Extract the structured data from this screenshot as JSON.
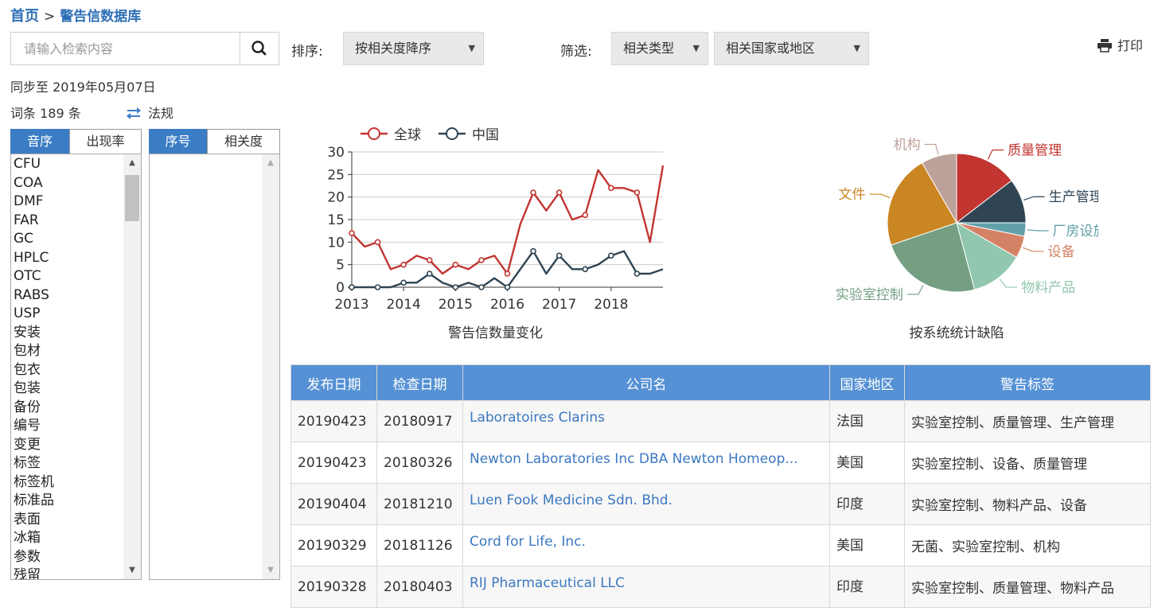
{
  "breadcrumb": {
    "home": "首页",
    "separator": ">",
    "current": "警告信数据库"
  },
  "search": {
    "placeholder": "请输入检索内容",
    "value": ""
  },
  "sort": {
    "label": "排序:",
    "selected": "按相关度降序"
  },
  "filter": {
    "label": "筛选:",
    "type_selected": "相关类型",
    "region_selected": "相关国家或地区"
  },
  "print_label": "打印",
  "sync_text": "同步至 2019年05月07日",
  "count_text": "词条 189 条",
  "law_link": "法规",
  "left_tabs": [
    "音序",
    "出现率"
  ],
  "right_tabs": [
    "序号",
    "相关度"
  ],
  "terms": [
    "CFU",
    "COA",
    "DMF",
    "FAR",
    "GC",
    "HPLC",
    "OTC",
    "RABS",
    "USP",
    "安装",
    "包材",
    "包衣",
    "包装",
    "备份",
    "编号",
    "变更",
    "标签",
    "标签机",
    "标准品",
    "表面",
    "冰箱",
    "参数",
    "残留"
  ],
  "chart_data": [
    {
      "type": "line",
      "title": "警告信数量变化",
      "x_ticks": [
        "2013",
        "2014",
        "2015",
        "2016",
        "2017",
        "2018"
      ],
      "y_ticks": [
        0,
        5,
        10,
        15,
        20,
        25,
        30
      ],
      "ylim": [
        0,
        30
      ],
      "xlim": [
        2013,
        2019
      ],
      "legend_position": "top",
      "grid": true,
      "series": [
        {
          "name": "全球",
          "color": "#c23531",
          "x": [
            2013,
            2013.25,
            2013.5,
            2013.75,
            2014,
            2014.25,
            2014.5,
            2014.75,
            2015,
            2015.25,
            2015.5,
            2015.75,
            2016,
            2016.25,
            2016.5,
            2016.75,
            2017,
            2017.25,
            2017.5,
            2017.75,
            2018,
            2018.25,
            2018.5,
            2018.75,
            2019
          ],
          "y": [
            12,
            9,
            10,
            4,
            5,
            7,
            6,
            3,
            5,
            4,
            6,
            7,
            3,
            14,
            21,
            17,
            21,
            15,
            16,
            26,
            22,
            22,
            21,
            10,
            27
          ],
          "markers": [
            1,
            0,
            1,
            0,
            1,
            0,
            1,
            0,
            1,
            0,
            1,
            0,
            1,
            0,
            1,
            0,
            1,
            0,
            1,
            0,
            1,
            0,
            1,
            0,
            0
          ]
        },
        {
          "name": "中国",
          "color": "#2f4554",
          "x": [
            2013,
            2013.25,
            2013.5,
            2013.75,
            2014,
            2014.25,
            2014.5,
            2014.75,
            2015,
            2015.25,
            2015.5,
            2015.75,
            2016,
            2016.25,
            2016.5,
            2016.75,
            2017,
            2017.25,
            2017.5,
            2017.75,
            2018,
            2018.25,
            2018.5,
            2018.75,
            2019
          ],
          "y": [
            0,
            0,
            0,
            0,
            1,
            1,
            3,
            1,
            0,
            1,
            0,
            2,
            0,
            4,
            8,
            3,
            7,
            4,
            4,
            5,
            7,
            8,
            3,
            3,
            4
          ],
          "markers": [
            1,
            0,
            1,
            0,
            1,
            0,
            1,
            0,
            1,
            0,
            1,
            0,
            1,
            0,
            1,
            0,
            1,
            0,
            1,
            0,
            1,
            0,
            1,
            0,
            0
          ]
        }
      ]
    },
    {
      "type": "pie",
      "title": "按系统统计缺陷",
      "slices": [
        {
          "label": "质量管理",
          "value": 14,
          "color": "#c23531"
        },
        {
          "label": "生产管理",
          "value": 10,
          "color": "#2f4554"
        },
        {
          "label": "厂房设施",
          "value": 3,
          "color": "#61a0a8"
        },
        {
          "label": "设备",
          "value": 5,
          "color": "#d48265"
        },
        {
          "label": "物料产品",
          "value": 12,
          "color": "#91c7ae"
        },
        {
          "label": "实验室控制",
          "value": 23,
          "color": "#749f83"
        },
        {
          "label": "文件",
          "value": 21,
          "color": "#ca8622"
        },
        {
          "label": "机构",
          "value": 8,
          "color": "#bda29a"
        }
      ]
    }
  ],
  "table": {
    "headers": [
      "发布日期",
      "检查日期",
      "公司名",
      "国家地区",
      "警告标签"
    ],
    "rows": [
      [
        "20190423",
        "20180917",
        "Laboratoires Clarins",
        "法国",
        "实验室控制、质量管理、生产管理"
      ],
      [
        "20190423",
        "20180326",
        "Newton Laboratories Inc DBA Newton Homeop...",
        "美国",
        "实验室控制、设备、质量管理"
      ],
      [
        "20190404",
        "20181210",
        "Luen Fook Medicine Sdn. Bhd.",
        "印度",
        "实验室控制、物料产品、设备"
      ],
      [
        "20190329",
        "20181126",
        "Cord for Life, Inc.",
        "美国",
        "无菌、实验室控制、机构"
      ],
      [
        "20190328",
        "20180403",
        "RIJ Pharmaceutical LLC",
        "印度",
        "实验室控制、质量管理、物料产品"
      ]
    ]
  },
  "colors": {
    "accent": "#3b7dc4",
    "table_header": "#5591d4",
    "link": "#3c78bf"
  },
  "icons": {
    "search": "search-icon",
    "print": "printer-icon",
    "law": "swap-arrows-icon"
  }
}
